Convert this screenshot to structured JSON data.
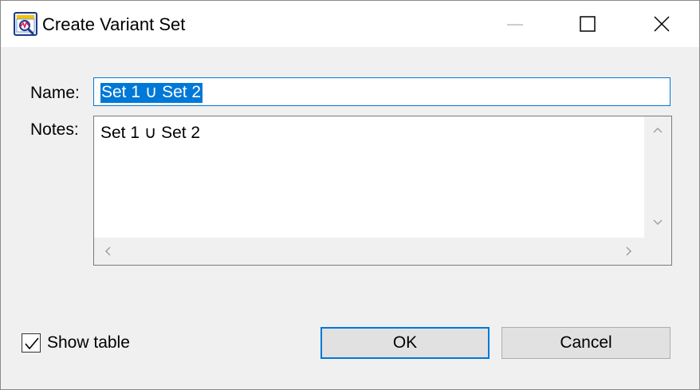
{
  "window": {
    "title": "Create Variant Set",
    "icon": "variant-app-icon"
  },
  "titlebar_buttons": {
    "minimize_icon": "minimize-icon",
    "maximize_icon": "maximize-icon",
    "close_icon": "close-icon"
  },
  "form": {
    "name_label": "Name:",
    "name_value": "Set 1 ∪ Set 2",
    "notes_label": "Notes:",
    "notes_value": "Set 1 ∪ Set 2"
  },
  "options": {
    "show_table_label": "Show table",
    "show_table_checked": true
  },
  "buttons": {
    "ok_label": "OK",
    "cancel_label": "Cancel"
  },
  "colors": {
    "accent": "#0078d7",
    "dialog_bg": "#f0f0f0",
    "button_bg": "#e1e1e1"
  }
}
